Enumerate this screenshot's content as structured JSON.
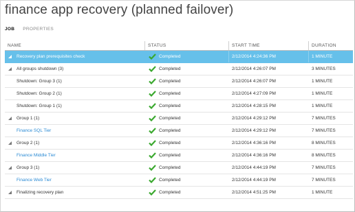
{
  "page": {
    "title": "finance app recovery (planned failover)"
  },
  "tabs": [
    {
      "label": "JOB"
    },
    {
      "label": "PROPERTIES"
    }
  ],
  "columns": [
    {
      "label": "NAME"
    },
    {
      "label": "STATUS"
    },
    {
      "label": "START TIME"
    },
    {
      "label": "DURATION"
    }
  ],
  "colors": {
    "selected_row": "#66c0ea",
    "link": "#2a8ad4",
    "check": "#3aa82e"
  },
  "rows": [
    {
      "name": "Recovery plan prerequisites check",
      "status": "Completed",
      "start": "2/12/2014 4:24:36 PM",
      "duration": "1 MINUTE"
    },
    {
      "name": "All groups shutdown (3)",
      "status": "Completed",
      "start": "2/12/2014 4:26:07 PM",
      "duration": "3 MINUTES"
    },
    {
      "name": "Shutdown: Group 3 (1)",
      "status": "Completed",
      "start": "2/12/2014 4:26:07 PM",
      "duration": "1 MINUTE"
    },
    {
      "name": "Shutdown: Group 2 (1)",
      "status": "Completed",
      "start": "2/12/2014 4:27:09 PM",
      "duration": "1 MINUTE"
    },
    {
      "name": "Shutdown: Group 1 (1)",
      "status": "Completed",
      "start": "2/12/2014 4:28:15 PM",
      "duration": "1 MINUTE"
    },
    {
      "name": "Group 1 (1)",
      "status": "Completed",
      "start": "2/12/2014 4:29:12 PM",
      "duration": "7 MINUTES"
    },
    {
      "name": "Finance SQL Tier",
      "status": "Completed",
      "start": "2/12/2014 4:29:12 PM",
      "duration": "7 MINUTES"
    },
    {
      "name": "Group 2 (1)",
      "status": "Completed",
      "start": "2/12/2014 4:36:16 PM",
      "duration": "8 MINUTES"
    },
    {
      "name": "Finance Middle Tier",
      "status": "Completed",
      "start": "2/12/2014 4:36:16 PM",
      "duration": "8 MINUTES"
    },
    {
      "name": "Group 3 (1)",
      "status": "Completed",
      "start": "2/12/2014 4:44:19 PM",
      "duration": "7 MINUTES"
    },
    {
      "name": "Finance Web Tier",
      "status": "Completed",
      "start": "2/12/2014 4:44:19 PM",
      "duration": "7 MINUTES"
    },
    {
      "name": "Finalizing recovery plan",
      "status": "Completed",
      "start": "2/12/2014 4:51:25 PM",
      "duration": "1 MINUTE"
    }
  ]
}
